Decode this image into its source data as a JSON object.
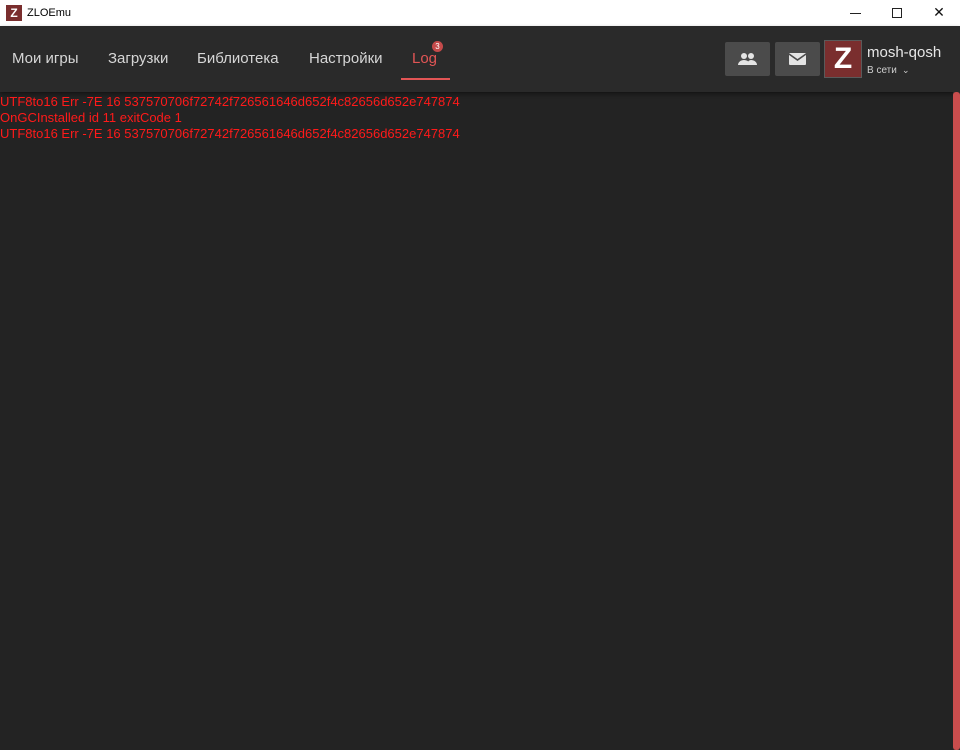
{
  "window": {
    "title": "ZLOEmu",
    "logo_letter": "Z",
    "controls": {
      "minimize": "",
      "maximize": "",
      "close": "✕"
    }
  },
  "nav": {
    "tabs": [
      {
        "label": "Мои игры",
        "active": false
      },
      {
        "label": "Загрузки",
        "active": false
      },
      {
        "label": "Библиотека",
        "active": false
      },
      {
        "label": "Настройки",
        "active": false
      },
      {
        "label": "Log",
        "active": true,
        "badge": "3"
      }
    ]
  },
  "actions": {
    "friends_icon": "people-icon",
    "mail_icon": "mail-icon"
  },
  "user": {
    "avatar_letter": "Z",
    "name": "mosh-qosh",
    "status": "В сети",
    "status_chevron": "⌄"
  },
  "log": {
    "lines": [
      "UTF8to16 Err -7E 16 537570706f72742f726561646d652f4c82656d652e747874",
      "OnGCInstalled id 11 exitCode 1",
      "UTF8to16 Err -7E 16 537570706f72742f726561646d652f4c82656d652e747874"
    ]
  },
  "colors": {
    "accent": "#e25555",
    "log_text": "#ff1a1a",
    "background": "#232323",
    "header": "#2a2a2a"
  }
}
